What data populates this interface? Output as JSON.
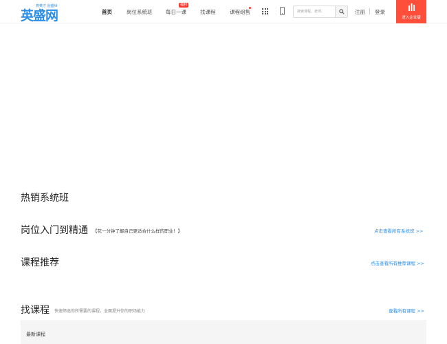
{
  "brand": {
    "logo_text": "英盛网",
    "slogan": "育英才 创盛世",
    "accent_color": "#2a8ee8",
    "highlight_color": "#ff4e3a"
  },
  "nav": {
    "items": [
      {
        "label": "首页",
        "active": true
      },
      {
        "label": "岗位系统班"
      },
      {
        "label": "每日一课",
        "badge": "福利"
      },
      {
        "label": "找课程"
      },
      {
        "label": "课程组售",
        "dot": true
      }
    ],
    "grid_icon": "grid-icon",
    "phone_icon": "mobile-phone-icon"
  },
  "search": {
    "placeholder": "搜索课程、老师、"
  },
  "auth": {
    "register": "注册",
    "login": "登录"
  },
  "enterprise": {
    "label": "进入企业版",
    "icon": "building-icon"
  },
  "sections": {
    "hot": {
      "title": "热销系统班"
    },
    "career": {
      "title": "岗位入门到精通",
      "subtitle": "【花一分钟了解自己更适合什么样的职业！】",
      "more": "点击查看所有系统班 >>"
    },
    "recommend": {
      "title": "课程推荐",
      "more": "点击查看所有推荐课程 >>"
    },
    "find": {
      "title": "找课程",
      "desc": "快速筛选你所需要的课程，全面提升你的职场能力",
      "more": "查看所有课程 >>"
    },
    "latest": {
      "title": "最新课程"
    }
  }
}
